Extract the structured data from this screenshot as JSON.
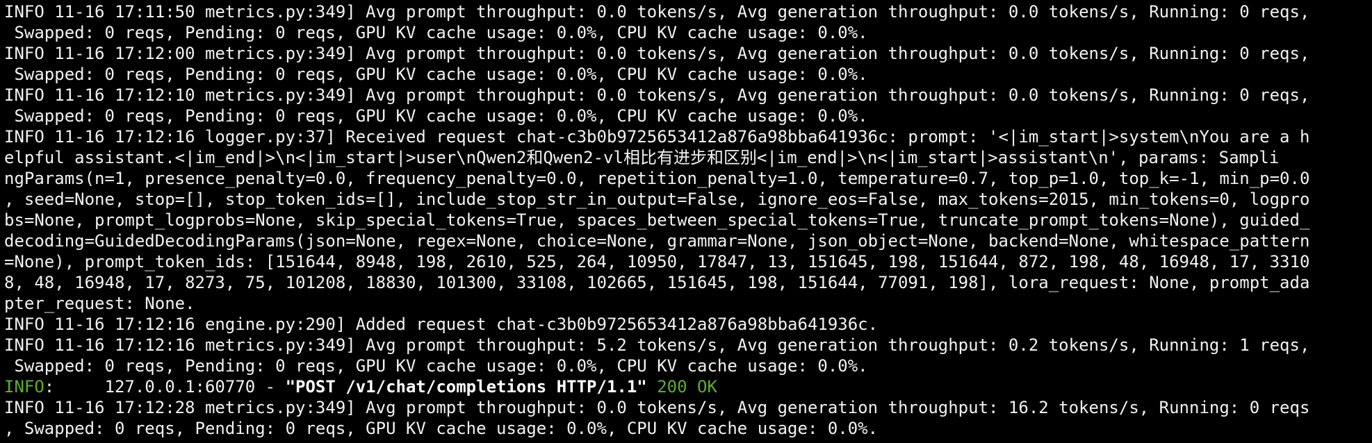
{
  "terminal": {
    "lines": [
      "INFO 11-16 17:11:50 metrics.py:349] Avg prompt throughput: 0.0 tokens/s, Avg generation throughput: 0.0 tokens/s, Running: 0 reqs,",
      " Swapped: 0 reqs, Pending: 0 reqs, GPU KV cache usage: 0.0%, CPU KV cache usage: 0.0%.",
      "INFO 11-16 17:12:00 metrics.py:349] Avg prompt throughput: 0.0 tokens/s, Avg generation throughput: 0.0 tokens/s, Running: 0 reqs,",
      " Swapped: 0 reqs, Pending: 0 reqs, GPU KV cache usage: 0.0%, CPU KV cache usage: 0.0%.",
      "INFO 11-16 17:12:10 metrics.py:349] Avg prompt throughput: 0.0 tokens/s, Avg generation throughput: 0.0 tokens/s, Running: 0 reqs,",
      " Swapped: 0 reqs, Pending: 0 reqs, GPU KV cache usage: 0.0%, CPU KV cache usage: 0.0%.",
      "INFO 11-16 17:12:16 logger.py:37] Received request chat-c3b0b9725653412a876a98bba641936c: prompt: '<|im_start|>system\\nYou are a h",
      "elpful assistant.<|im_end|>\\n<|im_start|>user\\nQwen2和Qwen2-vl相比有进步和区别<|im_end|>\\n<|im_start|>assistant\\n', params: Sampli",
      "ngParams(n=1, presence_penalty=0.0, frequency_penalty=0.0, repetition_penalty=1.0, temperature=0.7, top_p=1.0, top_k=-1, min_p=0.0",
      ", seed=None, stop=[], stop_token_ids=[], include_stop_str_in_output=False, ignore_eos=False, max_tokens=2015, min_tokens=0, logpro",
      "bs=None, prompt_logprobs=None, skip_special_tokens=True, spaces_between_special_tokens=True, truncate_prompt_tokens=None), guided_",
      "decoding=GuidedDecodingParams(json=None, regex=None, choice=None, grammar=None, json_object=None, backend=None, whitespace_pattern",
      "=None), prompt_token_ids: [151644, 8948, 198, 2610, 525, 264, 10950, 17847, 13, 151645, 198, 151644, 872, 198, 48, 16948, 17, 3310",
      "8, 48, 16948, 17, 8273, 75, 101208, 18830, 101300, 33108, 102665, 151645, 198, 151644, 77091, 198], lora_request: None, prompt_ada",
      "pter_request: None.",
      "INFO 11-16 17:12:16 engine.py:290] Added request chat-c3b0b9725653412a876a98bba641936c.",
      "INFO 11-16 17:12:16 metrics.py:349] Avg prompt throughput: 5.2 tokens/s, Avg generation throughput: 0.2 tokens/s, Running: 1 reqs,",
      " Swapped: 0 reqs, Pending: 0 reqs, GPU KV cache usage: 0.0%, CPU KV cache usage: 0.0%."
    ],
    "access_log": {
      "level": "INFO",
      "separator": ":     127.0.0.1:60770 - ",
      "request": "\"POST /v1/chat/completions HTTP/1.1\"",
      "status": " 200 OK"
    },
    "tail_lines": [
      "INFO 11-16 17:12:28 metrics.py:349] Avg prompt throughput: 0.0 tokens/s, Avg generation throughput: 16.2 tokens/s, Running: 0 reqs",
      ", Swapped: 0 reqs, Pending: 0 reqs, GPU KV cache usage: 0.0%, CPU KV cache usage: 0.0%."
    ],
    "colors": {
      "background": "#000000",
      "text": "#f2f2f2",
      "info_green": "#5faf2f"
    }
  }
}
